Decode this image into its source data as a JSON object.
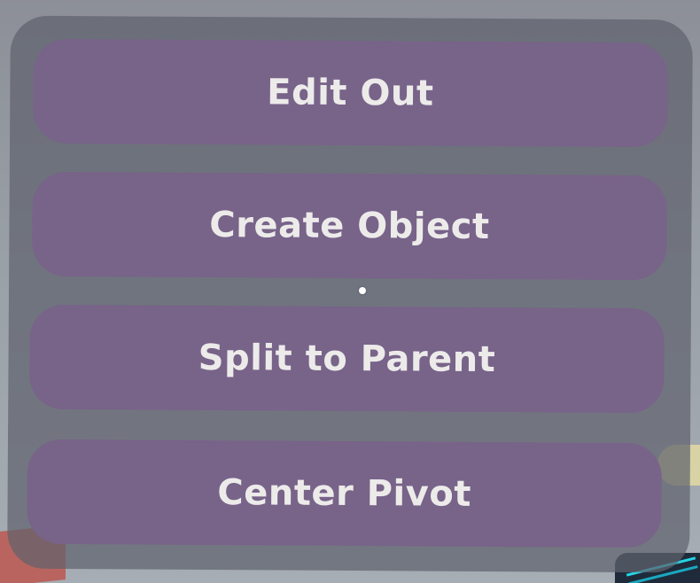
{
  "menu": {
    "buttons": [
      {
        "label": "Edit Out"
      },
      {
        "label": "Create Object"
      },
      {
        "label": "Split to Parent"
      },
      {
        "label": "Center Pivot"
      }
    ]
  },
  "colors": {
    "button_fill": "#786389",
    "button_text": "#ecebea",
    "panel_fill": "#60636e",
    "background": "#9aa0a8"
  }
}
